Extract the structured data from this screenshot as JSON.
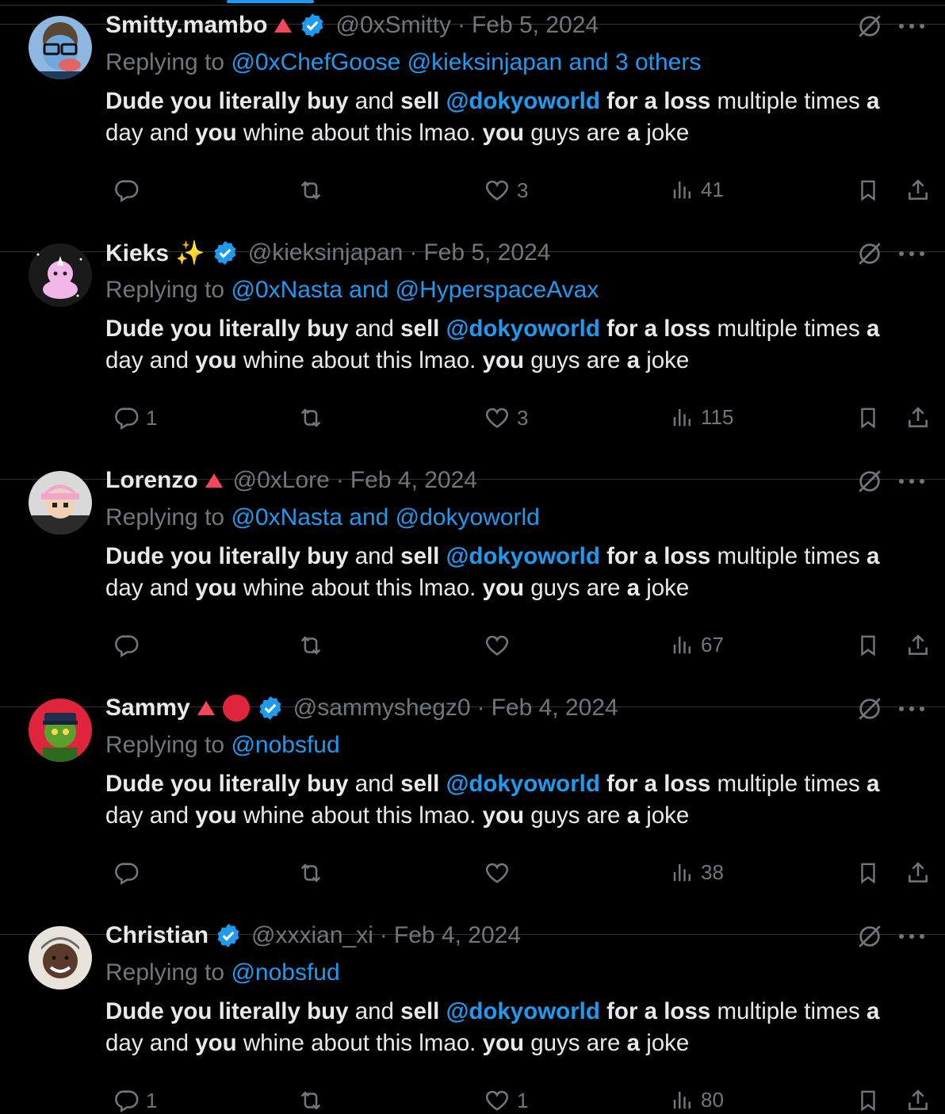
{
  "body_parts": [
    {
      "t": "Dude you literally buy",
      "s": "b"
    },
    {
      "t": " and ",
      "s": "n"
    },
    {
      "t": "sell",
      "s": "b"
    },
    {
      "t": " ",
      "s": "n"
    },
    {
      "t": "@dokyoworld",
      "s": "l"
    },
    {
      "t": " ",
      "s": "n"
    },
    {
      "t": "for a loss",
      "s": "b"
    },
    {
      "t": " multiple times ",
      "s": "n"
    },
    {
      "t": "a",
      "s": "b"
    },
    {
      "t": " day and ",
      "s": "n"
    },
    {
      "t": "you",
      "s": "b"
    },
    {
      "t": " whine about this lmao. ",
      "s": "n"
    },
    {
      "t": "you",
      "s": "b"
    },
    {
      "t": " guys are ",
      "s": "n"
    },
    {
      "t": "a",
      "s": "b"
    },
    {
      "t": " joke",
      "s": "n"
    }
  ],
  "colors": {
    "link": "#1d9bf0",
    "muted": "#71767b",
    "text": "#e7e9ea",
    "verified": "#1d9bf0",
    "triangle": "#f4475b",
    "red_dot": "#e0243c"
  },
  "tweets": [
    {
      "name": "Smitty.mambo",
      "badges": [
        "triangle",
        "verified"
      ],
      "handle": "@0xSmitty",
      "dot": "·",
      "date": "Feb 5, 2024",
      "replying_prefix": "Replying to",
      "replying_to": "@0xChefGoose @kieksinjapan and 3 others",
      "replies": "",
      "reposts": "",
      "likes": "3",
      "views": "41",
      "icons": [
        "reply-icon",
        "repost-icon",
        "like-icon",
        "views-icon",
        "bookmark-icon",
        "share-icon"
      ]
    },
    {
      "name": "Kieks ✨",
      "badges": [
        "verified"
      ],
      "handle": "@kieksinjapan",
      "dot": "·",
      "date": "Feb 5, 2024",
      "replying_prefix": "Replying to",
      "replying_to": "@0xNasta and @HyperspaceAvax",
      "replies": "1",
      "reposts": "",
      "likes": "3",
      "views": "115"
    },
    {
      "name": "Lorenzo",
      "badges": [
        "triangle"
      ],
      "handle": "@0xLore",
      "dot": "·",
      "date": "Feb 4, 2024",
      "replying_prefix": "Replying to",
      "replying_to": "@0xNasta and @dokyoworld",
      "replies": "",
      "reposts": "",
      "likes": "",
      "views": "67"
    },
    {
      "name": "Sammy",
      "badges": [
        "triangle",
        "red-dot",
        "verified"
      ],
      "handle": "@sammyshegz0",
      "dot": "·",
      "date": "Feb 4, 2024",
      "replying_prefix": "Replying to",
      "replying_to": "@nobsfud",
      "replies": "",
      "reposts": "",
      "likes": "",
      "views": "38"
    },
    {
      "name": "Christian",
      "badges": [
        "verified"
      ],
      "handle": "@xxxian_xi",
      "dot": "·",
      "date": "Feb 4, 2024",
      "replying_prefix": "Replying to",
      "replying_to": "@nobsfud",
      "replies": "1",
      "reposts": "",
      "likes": "1",
      "views": "80"
    }
  ]
}
